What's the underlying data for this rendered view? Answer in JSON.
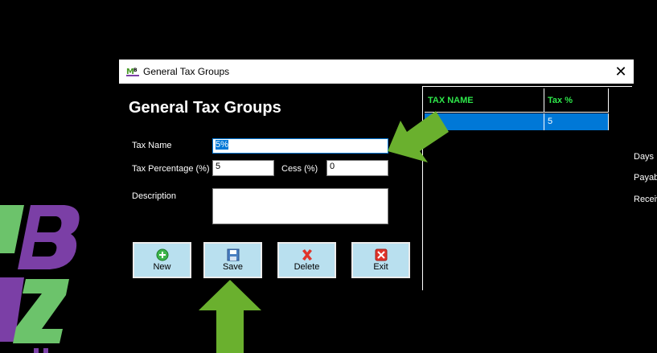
{
  "window": {
    "title": "General Tax Groups",
    "close_glyph": "✕",
    "app_icon": "mb-logo-icon"
  },
  "form": {
    "heading": "General Tax Groups",
    "tax_name_label": "Tax Name",
    "tax_name_value": "5%",
    "tax_percentage_label": "Tax Percentage (%)",
    "tax_percentage_value": "5",
    "cess_label": "Cess (%)",
    "cess_value": "0",
    "description_label": "Description",
    "description_value": ""
  },
  "buttons": {
    "new_label": "New",
    "save_label": "Save",
    "delete_label": "Delete",
    "exit_label": "Exit"
  },
  "grid": {
    "columns": [
      "TAX NAME",
      "Tax %"
    ],
    "rows": [
      {
        "tax_name": "",
        "tax_pct": "5"
      }
    ]
  },
  "side_labels": [
    "Days",
    "Payab",
    "Receiv"
  ],
  "colors": {
    "grid_header_text": "#2ee64a",
    "selected_row": "#0078d7",
    "button_bg": "#b9e0ef",
    "arrow_green": "#6ab02e"
  }
}
